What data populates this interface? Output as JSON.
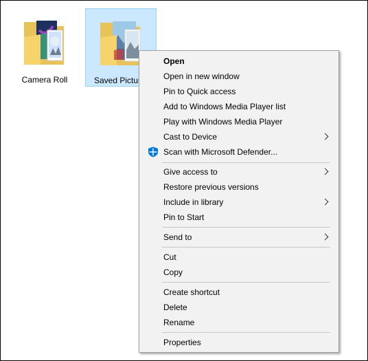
{
  "desktop": {
    "folders": [
      {
        "label": "Camera Roll",
        "selected": false
      },
      {
        "label": "Saved Pictures",
        "selected": true
      }
    ]
  },
  "context_menu": {
    "items": [
      {
        "label": "Open",
        "bold": true
      },
      {
        "label": "Open in new window"
      },
      {
        "label": "Pin to Quick access"
      },
      {
        "label": "Add to Windows Media Player list"
      },
      {
        "label": "Play with Windows Media Player"
      },
      {
        "label": "Cast to Device",
        "submenu": true
      },
      {
        "label": "Scan with Microsoft Defender...",
        "icon": "defender-shield-icon"
      },
      {
        "label": "Give access to",
        "submenu": true
      },
      {
        "label": "Restore previous versions"
      },
      {
        "label": "Include in library",
        "submenu": true
      },
      {
        "label": "Pin to Start"
      },
      {
        "label": "Send to",
        "submenu": true
      },
      {
        "label": "Cut"
      },
      {
        "label": "Copy"
      },
      {
        "label": "Create shortcut"
      },
      {
        "label": "Delete"
      },
      {
        "label": "Rename"
      },
      {
        "label": "Properties"
      }
    ]
  },
  "colors": {
    "selection_fill": "#cce8ff",
    "selection_border": "#99d1ff",
    "menu_background": "#f2f2f2",
    "defender_blue": "#0078d7"
  }
}
